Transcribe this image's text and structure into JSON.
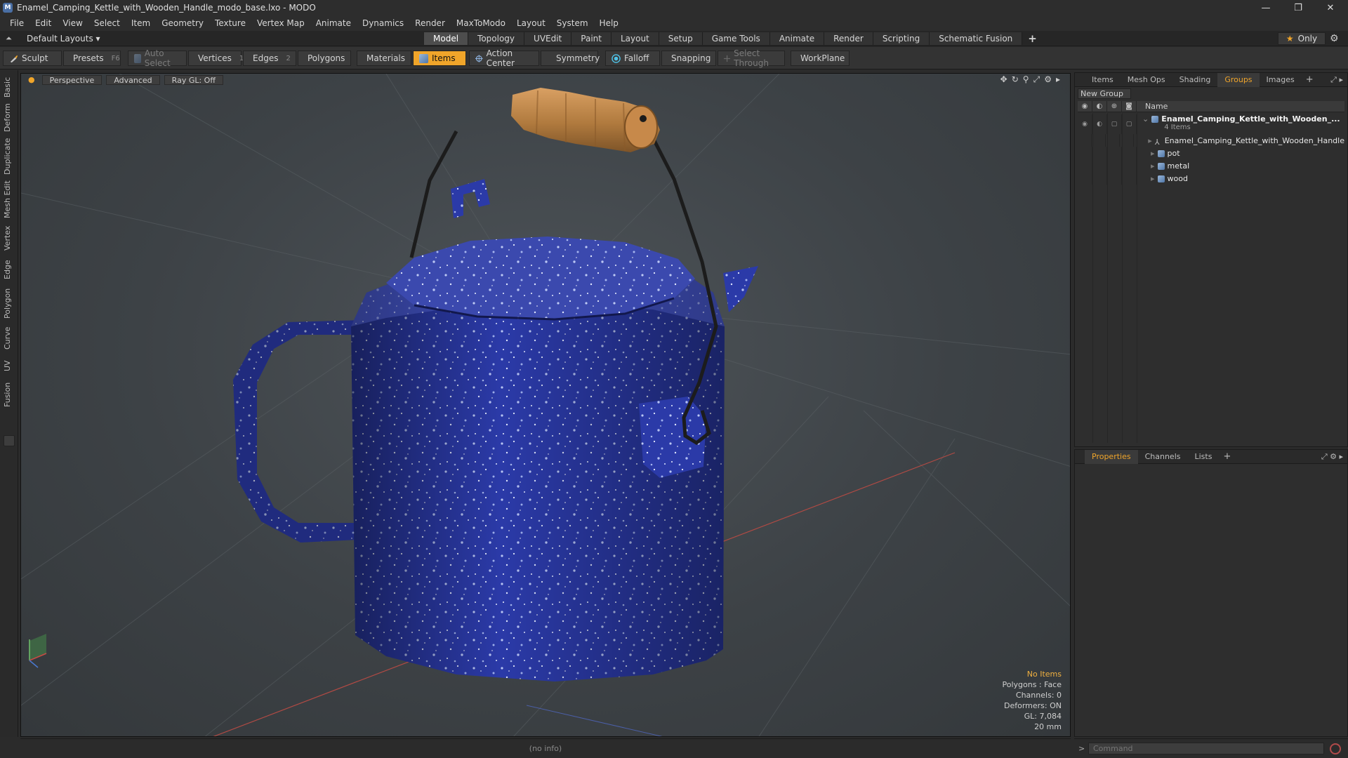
{
  "window": {
    "title": "Enamel_Camping_Kettle_with_Wooden_Handle_modo_base.lxo - MODO",
    "app_icon": "modo-logo-icon",
    "controls": {
      "minimize": "—",
      "restore": "❐",
      "close": "✕"
    }
  },
  "menubar": {
    "items": [
      "File",
      "Edit",
      "View",
      "Select",
      "Item",
      "Geometry",
      "Texture",
      "Vertex Map",
      "Animate",
      "Dynamics",
      "Render",
      "MaxToModo",
      "Layout",
      "System",
      "Help"
    ]
  },
  "layoutbar": {
    "layout_dropdown": "Default Layouts ▾",
    "mode_tabs": [
      "Model",
      "Topology",
      "UVEdit",
      "Paint",
      "Layout",
      "Setup",
      "Game Tools",
      "Animate",
      "Render",
      "Scripting",
      "Schematic Fusion"
    ],
    "active_tab": "Model",
    "add_tab": "+",
    "only_label": "Only"
  },
  "toolbar": {
    "sculpt": "Sculpt",
    "presets": "Presets",
    "presets_key": "F6",
    "auto_select": "Auto Select",
    "vertices": "Vertices",
    "vertices_count": "1",
    "edges": "Edges",
    "edges_count": "2",
    "polygons": "Polygons",
    "materials": "Materials",
    "items": "Items",
    "action_center": "Action Center",
    "symmetry": "Symmetry",
    "falloff": "Falloff",
    "snapping": "Snapping",
    "select_through": "Select Through",
    "workplane": "WorkPlane"
  },
  "left_tabs": [
    "Basic",
    "Deform",
    "Duplicate",
    "Mesh Edit",
    "Vertex",
    "Edge",
    "Polygon",
    "Curve",
    "UV",
    "Fusion"
  ],
  "viewport": {
    "view_mode": "Perspective",
    "shading": "Advanced",
    "raygl": "Ray GL: Off",
    "info": {
      "selection": "No Items",
      "polygons": "Polygons : Face",
      "channels": "Channels: 0",
      "deformers": "Deformers: ON",
      "gl": "GL: 7,084",
      "unit": "20 mm"
    }
  },
  "statusbar": {
    "text": "(no info)"
  },
  "right_panel_top": {
    "tabs": [
      "Items",
      "Mesh Ops",
      "Shading",
      "Groups",
      "Images"
    ],
    "active_tab": "Groups",
    "add_tab": "+",
    "new_group": "New Group",
    "column_name": "Name",
    "tree": {
      "root": {
        "label": "Enamel_Camping_Kettle_with_Wooden_...",
        "sub": "4 Items"
      },
      "children": [
        "Enamel_Camping_Kettle_with_Wooden_Handle",
        "pot",
        "metal",
        "wood"
      ]
    }
  },
  "right_panel_bottom": {
    "tabs": [
      "Properties",
      "Channels",
      "Lists"
    ],
    "active_tab": "Properties",
    "add_tab": "+"
  },
  "command": {
    "placeholder": "Command",
    "caret": ">"
  },
  "colors": {
    "accent": "#f0a52a",
    "enamel_blue": "#2b3aa8",
    "wood": "#b07a3e"
  }
}
